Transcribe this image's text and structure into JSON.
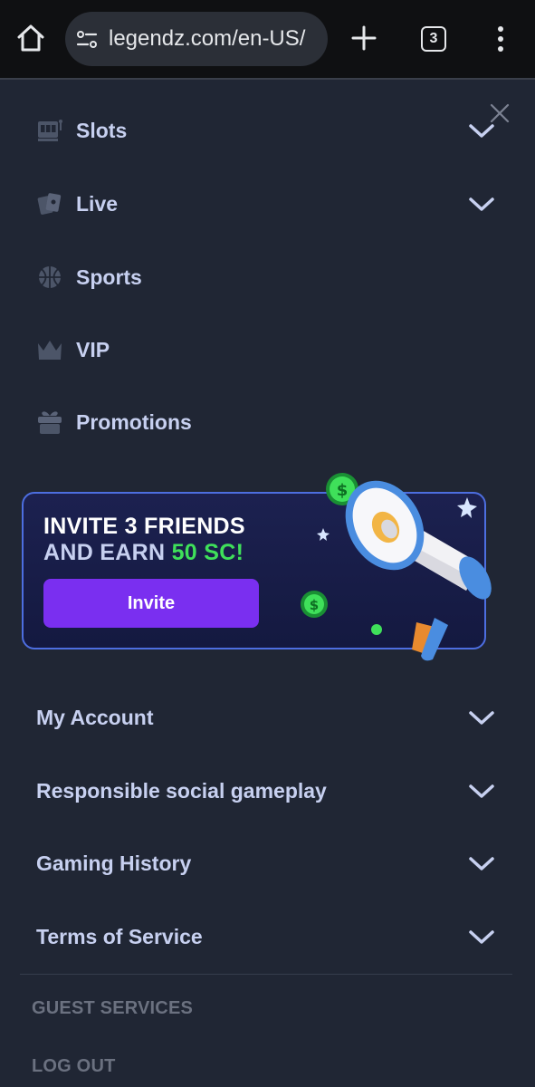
{
  "browser": {
    "url": "legendz.com/en-US/",
    "tab_count": "3"
  },
  "menu": {
    "items": [
      {
        "label": "Slots",
        "icon": "slot-machine-icon",
        "expandable": true
      },
      {
        "label": "Live",
        "icon": "cards-icon",
        "expandable": true
      },
      {
        "label": "Sports",
        "icon": "basketball-icon",
        "expandable": false
      },
      {
        "label": "VIP",
        "icon": "crown-icon",
        "expandable": false
      },
      {
        "label": "Promotions",
        "icon": "gift-icon",
        "expandable": false
      }
    ]
  },
  "promo": {
    "line1": "INVITE 3 FRIENDS",
    "line2_prefix": "AND EARN ",
    "line2_amount": "50 SC!",
    "button_label": "Invite"
  },
  "account": {
    "items": [
      {
        "label": "My Account"
      },
      {
        "label": "Responsible social gameplay"
      },
      {
        "label": "Gaming History"
      },
      {
        "label": "Terms of Service"
      }
    ]
  },
  "footer": {
    "guest_services": "GUEST SERVICES",
    "logout": "LOG OUT"
  },
  "colors": {
    "background": "#202634",
    "nav_text": "#c7d0f0",
    "invite_button": "#7a2ff0",
    "promo_amount": "#3fe05a",
    "promo_border": "#4d6ee0"
  }
}
